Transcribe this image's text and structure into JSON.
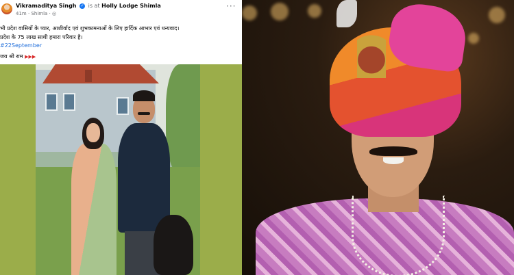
{
  "post": {
    "author": "Vikramaditya Singh",
    "is_at": "is at",
    "place": "Holly Lodge Shimla",
    "time": "41m",
    "location": "Shimla",
    "more": "···",
    "lines": [
      "भी प्रदेश वासियों के प्यार, आशीर्वाद एवं शुभकामनाओं के लिए हार्दिक आभार एवं धन्यवाद।",
      "प्रदेश के 75  लाख  साथी हमारा परिवार है।",
      "#22September",
      "जय श्री राम"
    ],
    "flags": "▶▶▶"
  },
  "colors": {
    "link": "#216fdb",
    "verified": "#1877f2",
    "post_bg_green": "#9bad4a"
  }
}
